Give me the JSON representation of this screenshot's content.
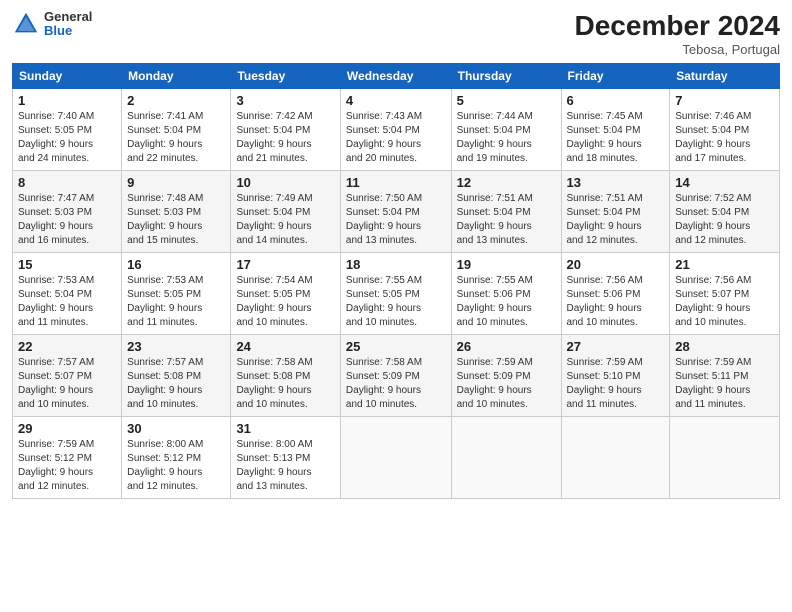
{
  "logo": {
    "general": "General",
    "blue": "Blue"
  },
  "header": {
    "month": "December 2024",
    "location": "Tebosa, Portugal"
  },
  "weekdays": [
    "Sunday",
    "Monday",
    "Tuesday",
    "Wednesday",
    "Thursday",
    "Friday",
    "Saturday"
  ],
  "weeks": [
    [
      {
        "day": "1",
        "info": "Sunrise: 7:40 AM\nSunset: 5:05 PM\nDaylight: 9 hours\nand 24 minutes."
      },
      {
        "day": "2",
        "info": "Sunrise: 7:41 AM\nSunset: 5:04 PM\nDaylight: 9 hours\nand 22 minutes."
      },
      {
        "day": "3",
        "info": "Sunrise: 7:42 AM\nSunset: 5:04 PM\nDaylight: 9 hours\nand 21 minutes."
      },
      {
        "day": "4",
        "info": "Sunrise: 7:43 AM\nSunset: 5:04 PM\nDaylight: 9 hours\nand 20 minutes."
      },
      {
        "day": "5",
        "info": "Sunrise: 7:44 AM\nSunset: 5:04 PM\nDaylight: 9 hours\nand 19 minutes."
      },
      {
        "day": "6",
        "info": "Sunrise: 7:45 AM\nSunset: 5:04 PM\nDaylight: 9 hours\nand 18 minutes."
      },
      {
        "day": "7",
        "info": "Sunrise: 7:46 AM\nSunset: 5:04 PM\nDaylight: 9 hours\nand 17 minutes."
      }
    ],
    [
      {
        "day": "8",
        "info": "Sunrise: 7:47 AM\nSunset: 5:03 PM\nDaylight: 9 hours\nand 16 minutes."
      },
      {
        "day": "9",
        "info": "Sunrise: 7:48 AM\nSunset: 5:03 PM\nDaylight: 9 hours\nand 15 minutes."
      },
      {
        "day": "10",
        "info": "Sunrise: 7:49 AM\nSunset: 5:04 PM\nDaylight: 9 hours\nand 14 minutes."
      },
      {
        "day": "11",
        "info": "Sunrise: 7:50 AM\nSunset: 5:04 PM\nDaylight: 9 hours\nand 13 minutes."
      },
      {
        "day": "12",
        "info": "Sunrise: 7:51 AM\nSunset: 5:04 PM\nDaylight: 9 hours\nand 13 minutes."
      },
      {
        "day": "13",
        "info": "Sunrise: 7:51 AM\nSunset: 5:04 PM\nDaylight: 9 hours\nand 12 minutes."
      },
      {
        "day": "14",
        "info": "Sunrise: 7:52 AM\nSunset: 5:04 PM\nDaylight: 9 hours\nand 12 minutes."
      }
    ],
    [
      {
        "day": "15",
        "info": "Sunrise: 7:53 AM\nSunset: 5:04 PM\nDaylight: 9 hours\nand 11 minutes."
      },
      {
        "day": "16",
        "info": "Sunrise: 7:53 AM\nSunset: 5:05 PM\nDaylight: 9 hours\nand 11 minutes."
      },
      {
        "day": "17",
        "info": "Sunrise: 7:54 AM\nSunset: 5:05 PM\nDaylight: 9 hours\nand 10 minutes."
      },
      {
        "day": "18",
        "info": "Sunrise: 7:55 AM\nSunset: 5:05 PM\nDaylight: 9 hours\nand 10 minutes."
      },
      {
        "day": "19",
        "info": "Sunrise: 7:55 AM\nSunset: 5:06 PM\nDaylight: 9 hours\nand 10 minutes."
      },
      {
        "day": "20",
        "info": "Sunrise: 7:56 AM\nSunset: 5:06 PM\nDaylight: 9 hours\nand 10 minutes."
      },
      {
        "day": "21",
        "info": "Sunrise: 7:56 AM\nSunset: 5:07 PM\nDaylight: 9 hours\nand 10 minutes."
      }
    ],
    [
      {
        "day": "22",
        "info": "Sunrise: 7:57 AM\nSunset: 5:07 PM\nDaylight: 9 hours\nand 10 minutes."
      },
      {
        "day": "23",
        "info": "Sunrise: 7:57 AM\nSunset: 5:08 PM\nDaylight: 9 hours\nand 10 minutes."
      },
      {
        "day": "24",
        "info": "Sunrise: 7:58 AM\nSunset: 5:08 PM\nDaylight: 9 hours\nand 10 minutes."
      },
      {
        "day": "25",
        "info": "Sunrise: 7:58 AM\nSunset: 5:09 PM\nDaylight: 9 hours\nand 10 minutes."
      },
      {
        "day": "26",
        "info": "Sunrise: 7:59 AM\nSunset: 5:09 PM\nDaylight: 9 hours\nand 10 minutes."
      },
      {
        "day": "27",
        "info": "Sunrise: 7:59 AM\nSunset: 5:10 PM\nDaylight: 9 hours\nand 11 minutes."
      },
      {
        "day": "28",
        "info": "Sunrise: 7:59 AM\nSunset: 5:11 PM\nDaylight: 9 hours\nand 11 minutes."
      }
    ],
    [
      {
        "day": "29",
        "info": "Sunrise: 7:59 AM\nSunset: 5:12 PM\nDaylight: 9 hours\nand 12 minutes."
      },
      {
        "day": "30",
        "info": "Sunrise: 8:00 AM\nSunset: 5:12 PM\nDaylight: 9 hours\nand 12 minutes."
      },
      {
        "day": "31",
        "info": "Sunrise: 8:00 AM\nSunset: 5:13 PM\nDaylight: 9 hours\nand 13 minutes."
      },
      null,
      null,
      null,
      null
    ]
  ]
}
